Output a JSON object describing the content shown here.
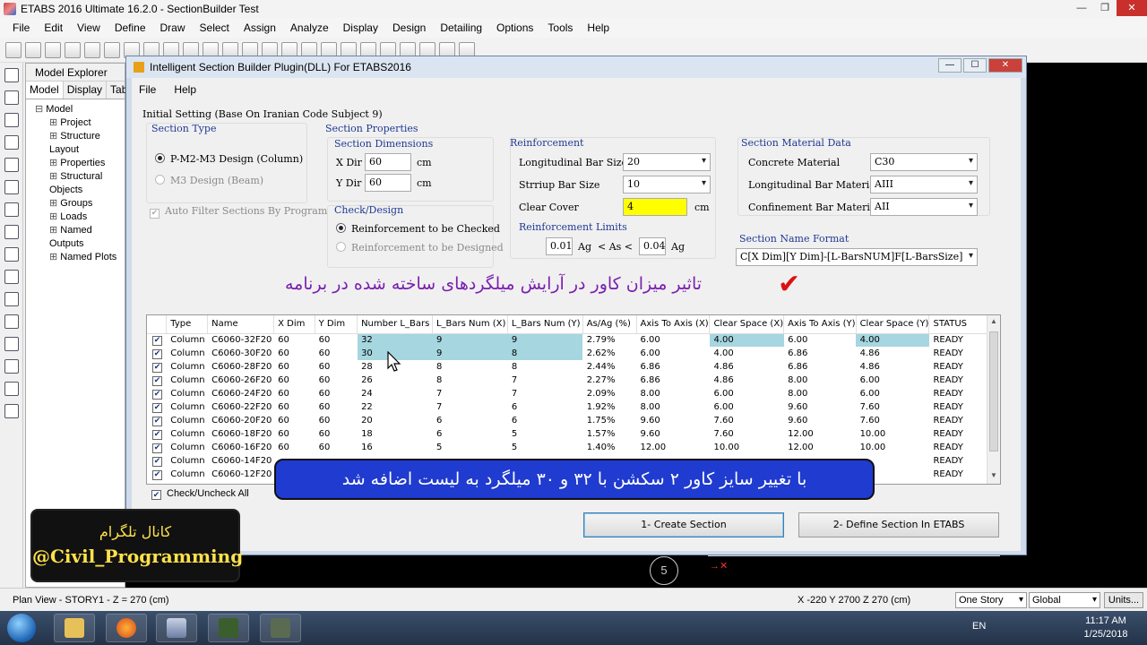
{
  "app": {
    "title": "ETABS 2016 Ultimate 16.2.0 - SectionBuilder Test",
    "menu": [
      "File",
      "Edit",
      "View",
      "Define",
      "Draw",
      "Select",
      "Assign",
      "Analyze",
      "Display",
      "Design",
      "Detailing",
      "Options",
      "Tools",
      "Help"
    ]
  },
  "explorer": {
    "title": "Model Explorer",
    "tabs": [
      "Model",
      "Display",
      "Tables"
    ],
    "root": "Model",
    "items": [
      "Project",
      "Structure Layout",
      "Properties",
      "Structural Objects",
      "Groups",
      "Loads",
      "Named Outputs",
      "Named Plots"
    ]
  },
  "status": {
    "view": "Plan View - STORY1 - Z = 270 (cm)",
    "coords": "X -220  Y 2700  Z 270 (cm)",
    "story": "One Story",
    "coord_sys": "Global",
    "units": "Units..."
  },
  "viewport": {
    "grid_bubble": "5"
  },
  "taskbar": {
    "lang": "EN",
    "time": "11:17 AM",
    "date": "1/25/2018"
  },
  "dialog": {
    "title": "Intelligent Section Builder Plugin(DLL) For ETABS2016",
    "menu": [
      "File",
      "Help"
    ],
    "initial_setting": "Initial Setting (Base On Iranian Code Subject 9)",
    "section_type": {
      "title": "Section Type",
      "options": [
        "P-M2-M3 Design (Column)",
        "M3 Design (Beam)"
      ],
      "auto_filter": "Auto Filter Sections By Program"
    },
    "section_properties": {
      "title": "Section Properties",
      "dimensions_title": "Section Dimensions",
      "x_label": "X Dir",
      "x_value": "60",
      "y_label": "Y Dir",
      "y_value": "60",
      "unit": "cm"
    },
    "check_design": {
      "title": "Check/Design",
      "options": [
        "Reinforcement to be Checked",
        "Reinforcement to be Designed"
      ]
    },
    "reinforcement": {
      "title": "Reinforcement",
      "long_label": "Longitudinal Bar Size",
      "long_value": "20",
      "stirrup_label": "Strriup Bar Size",
      "stirrup_value": "10",
      "cover_label": "Clear Cover",
      "cover_value": "4",
      "cover_unit": "cm",
      "limits_title": "Reinforcement Limits",
      "min": "0.01",
      "max": "0.04",
      "ag": "Ag",
      "between": "<  As  <"
    },
    "material": {
      "title": "Section Material Data",
      "concrete_label": "Concrete Material",
      "concrete_value": "C30",
      "long_label": "Longitudinal Bar Material",
      "long_value": "AIII",
      "conf_label": "Confinement Bar Material",
      "conf_value": "AII"
    },
    "name_format": {
      "title": "Section Name Format",
      "value": "C[X Dim][Y Dim]-[L-BarsNUM]F[L-BarsSize]"
    },
    "table": {
      "columns": [
        "Type",
        "Name",
        "X Dim",
        "Y Dim",
        "Number L_Bars",
        "L_Bars Num (X)",
        "L_Bars Num (Y)",
        "As/Ag (%)",
        "Axis To Axis (X)",
        "Clear Space (X)",
        "Axis To Axis (Y)",
        "Clear Space (Y)",
        "STATUS"
      ],
      "rows": [
        [
          "Column",
          "C6060-32F20",
          "60",
          "60",
          "32",
          "9",
          "9",
          "2.79%",
          "6.00",
          "4.00",
          "6.00",
          "4.00",
          "READY"
        ],
        [
          "Column",
          "C6060-30F20",
          "60",
          "60",
          "30",
          "9",
          "8",
          "2.62%",
          "6.00",
          "4.00",
          "6.86",
          "4.86",
          "READY"
        ],
        [
          "Column",
          "C6060-28F20",
          "60",
          "60",
          "28",
          "8",
          "8",
          "2.44%",
          "6.86",
          "4.86",
          "6.86",
          "4.86",
          "READY"
        ],
        [
          "Column",
          "C6060-26F20",
          "60",
          "60",
          "26",
          "8",
          "7",
          "2.27%",
          "6.86",
          "4.86",
          "8.00",
          "6.00",
          "READY"
        ],
        [
          "Column",
          "C6060-24F20",
          "60",
          "60",
          "24",
          "7",
          "7",
          "2.09%",
          "8.00",
          "6.00",
          "8.00",
          "6.00",
          "READY"
        ],
        [
          "Column",
          "C6060-22F20",
          "60",
          "60",
          "22",
          "7",
          "6",
          "1.92%",
          "8.00",
          "6.00",
          "9.60",
          "7.60",
          "READY"
        ],
        [
          "Column",
          "C6060-20F20",
          "60",
          "60",
          "20",
          "6",
          "6",
          "1.75%",
          "9.60",
          "7.60",
          "9.60",
          "7.60",
          "READY"
        ],
        [
          "Column",
          "C6060-18F20",
          "60",
          "60",
          "18",
          "6",
          "5",
          "1.57%",
          "9.60",
          "7.60",
          "12.00",
          "10.00",
          "READY"
        ],
        [
          "Column",
          "C6060-16F20",
          "60",
          "60",
          "16",
          "5",
          "5",
          "1.40%",
          "12.00",
          "10.00",
          "12.00",
          "10.00",
          "READY"
        ],
        [
          "Column",
          "C6060-14F20",
          "",
          "",
          "",
          "",
          "",
          "",
          "",
          "",
          "",
          "",
          "READY"
        ],
        [
          "Column",
          "C6060-12F20",
          "",
          "",
          "",
          "",
          "",
          "",
          "",
          "",
          "",
          "",
          "READY"
        ]
      ]
    },
    "check_all": "Check/Uncheck All",
    "btn_create": "1- Create Section",
    "btn_define": "2- Define Section In ETABS"
  },
  "overlays": {
    "note": "تاثیر میزان کاور در آرایش میلگردهای ساخته شده در برنامه",
    "banner": "با تغییر سایز کاور ۲ سکشن با ۳۲ و ۳۰ میلگرد به لیست اضافه شد",
    "telegram_title": "کانال تلگرام",
    "telegram_handle": "@Civil_Programming"
  }
}
